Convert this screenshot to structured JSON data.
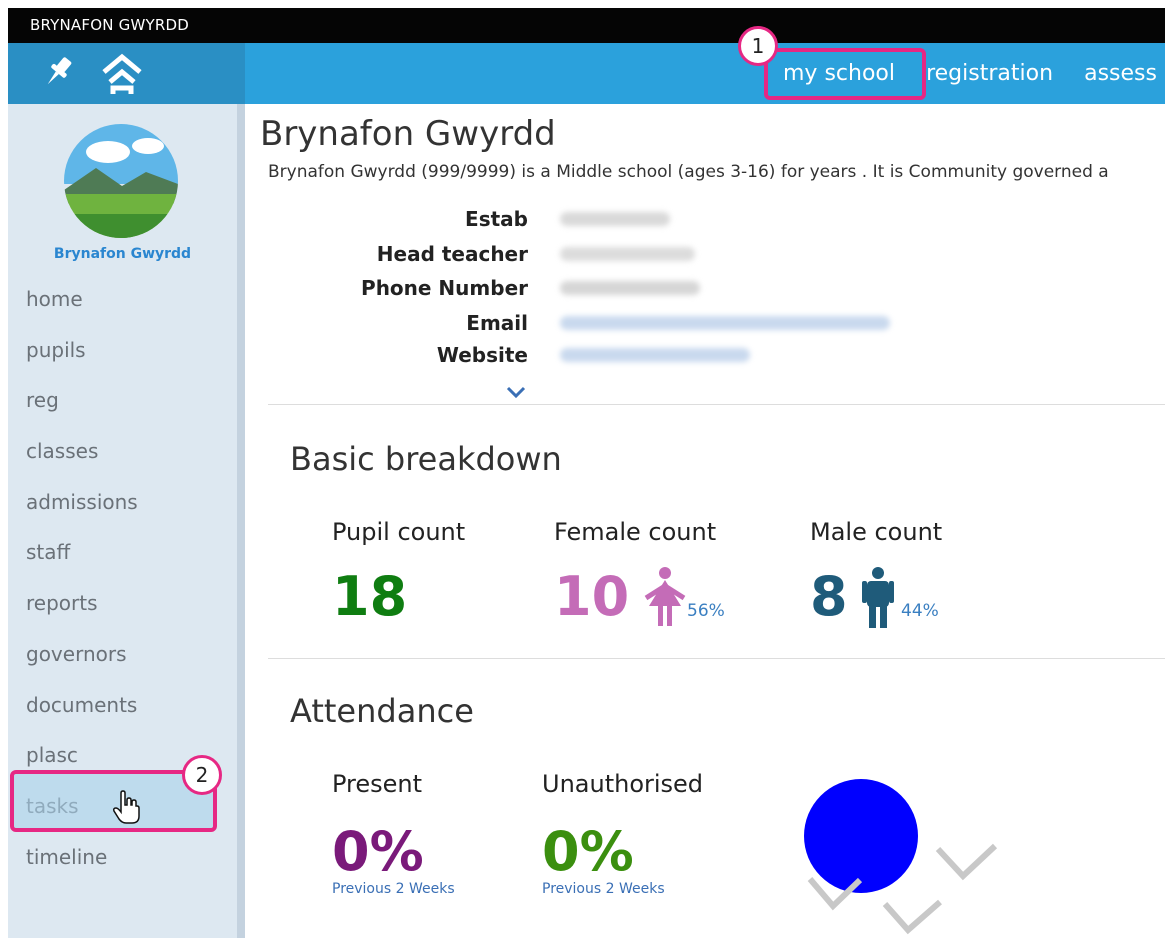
{
  "app": {
    "title": "BRYNAFON GWYRDD"
  },
  "toolbar": {
    "icons": [
      "pin-icon",
      "home-icon"
    ]
  },
  "nav": {
    "links": [
      "my school",
      "registration",
      "assess"
    ]
  },
  "sidebar": {
    "logo_name": "Brynafon Gwyrdd",
    "items": [
      "home",
      "pupils",
      "reg",
      "classes",
      "admissions",
      "staff",
      "reports",
      "governors",
      "documents",
      "plasc",
      "tasks",
      "timeline"
    ]
  },
  "annotations": {
    "marker1": "1",
    "marker2": "2"
  },
  "school": {
    "title": "Brynafon Gwyrdd",
    "summary": "Brynafon Gwyrdd (999/9999) is a Middle school (ages 3-16) for years . It is Community governed a",
    "info_labels": [
      "Estab",
      "Head teacher",
      "Phone Number",
      "Email",
      "Website"
    ]
  },
  "breakdown": {
    "title": "Basic breakdown",
    "pupil_label": "Pupil count",
    "pupil_value": "18",
    "female_label": "Female count",
    "female_value": "10",
    "female_pct": "56%",
    "male_label": "Male count",
    "male_value": "8",
    "male_pct": "44%"
  },
  "attendance": {
    "title": "Attendance",
    "present_label": "Present",
    "present_value": "0%",
    "present_note": "Previous 2 Weeks",
    "unauth_label": "Unauthorised",
    "unauth_value": "0%",
    "unauth_note": "Previous 2 Weeks"
  },
  "colors": {
    "accent": "#2ba1dc",
    "highlight": "#e62884",
    "pupil_green": "#0f7d11",
    "female_pink": "#c46cb7",
    "male_teal": "#1f5b7a",
    "present_purple": "#7a1a7a",
    "unauth_green": "#3b8f0f",
    "chart_blue": "#0000ff"
  }
}
